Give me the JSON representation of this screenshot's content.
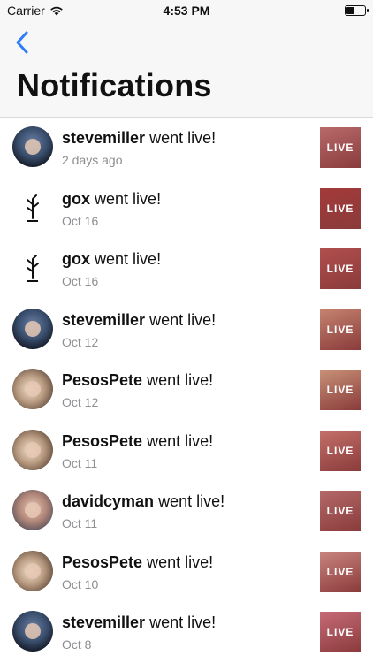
{
  "status": {
    "carrier": "Carrier",
    "time": "4:53 PM"
  },
  "nav": {
    "title": "Notifications"
  },
  "suffix": "went live!",
  "live_label": "LIVE",
  "items": [
    {
      "user": "stevemiller",
      "date": "2 days ago",
      "avatar": "sm",
      "thumb": "#b86a6a"
    },
    {
      "user": "gox",
      "date": "Oct 16",
      "avatar": "gox",
      "thumb": "#a33a3a"
    },
    {
      "user": "gox",
      "date": "Oct 16",
      "avatar": "gox",
      "thumb": "#b24e4e"
    },
    {
      "user": "stevemiller",
      "date": "Oct 12",
      "avatar": "sm",
      "thumb": "#c4836f"
    },
    {
      "user": "PesosPete",
      "date": "Oct 12",
      "avatar": "pp",
      "thumb": "#c89277"
    },
    {
      "user": "PesosPete",
      "date": "Oct 11",
      "avatar": "pp",
      "thumb": "#c4706a"
    },
    {
      "user": "davidcyman",
      "date": "Oct 11",
      "avatar": "dc",
      "thumb": "#b36a68"
    },
    {
      "user": "PesosPete",
      "date": "Oct 10",
      "avatar": "pp",
      "thumb": "#c9847f"
    },
    {
      "user": "stevemiller",
      "date": "Oct 8",
      "avatar": "sm",
      "thumb": "#c66a78"
    }
  ]
}
